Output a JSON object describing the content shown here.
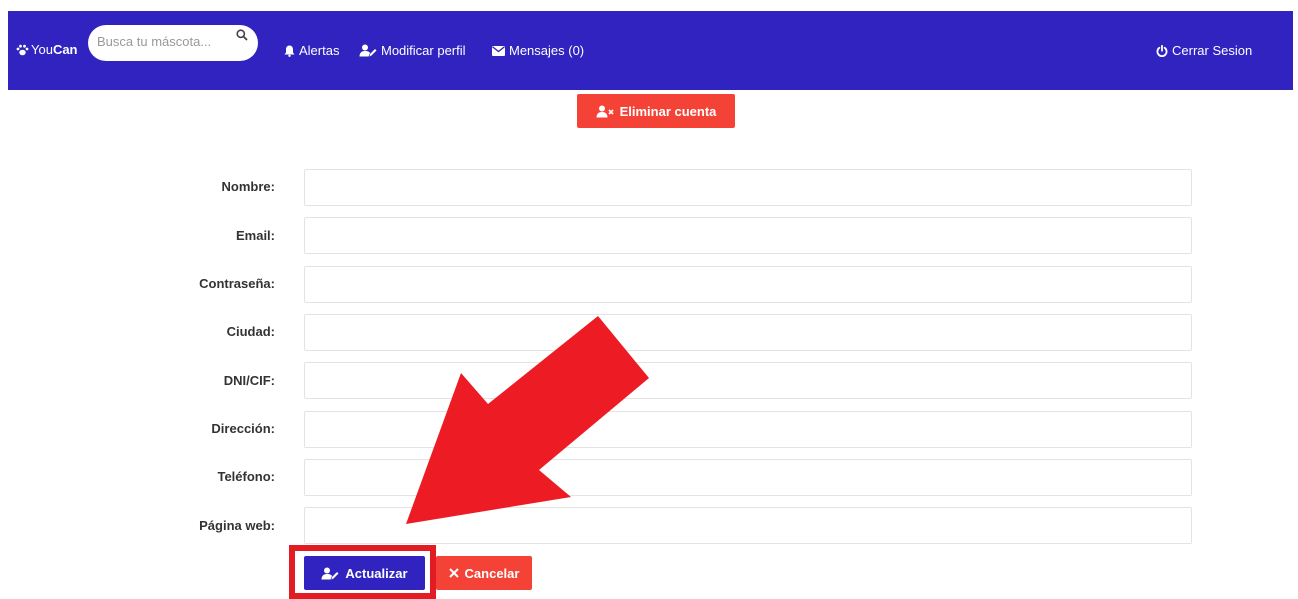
{
  "navbar": {
    "brand_prefix": "You",
    "brand_suffix": "Can",
    "search_placeholder": "Busca tu máscota...",
    "links": {
      "alertas": "Alertas",
      "modificar_perfil": "Modificar perfil",
      "mensajes": "Mensajes (0)"
    },
    "logout": "Cerrar Sesion"
  },
  "delete_account": "Eliminar cuenta",
  "form": {
    "fields": [
      {
        "label": "Nombre:",
        "value": ""
      },
      {
        "label": "Email:",
        "value": ""
      },
      {
        "label": "Contraseña:",
        "value": ""
      },
      {
        "label": "Ciudad:",
        "value": ""
      },
      {
        "label": "DNI/CIF:",
        "value": ""
      },
      {
        "label": "Dirección:",
        "value": ""
      },
      {
        "label": "Teléfono:",
        "value": ""
      },
      {
        "label": "Página web:",
        "value": ""
      }
    ],
    "submit": "Actualizar",
    "cancel": "Cancelar"
  },
  "colors": {
    "primary": "#3023bf",
    "danger": "#f44336",
    "annotation": "#e31b23"
  },
  "icons": [
    "paw-icon",
    "search-icon",
    "bell-icon",
    "user-edit-icon",
    "envelope-icon",
    "power-icon",
    "user-times-icon",
    "times-icon",
    "annotation-arrow"
  ]
}
